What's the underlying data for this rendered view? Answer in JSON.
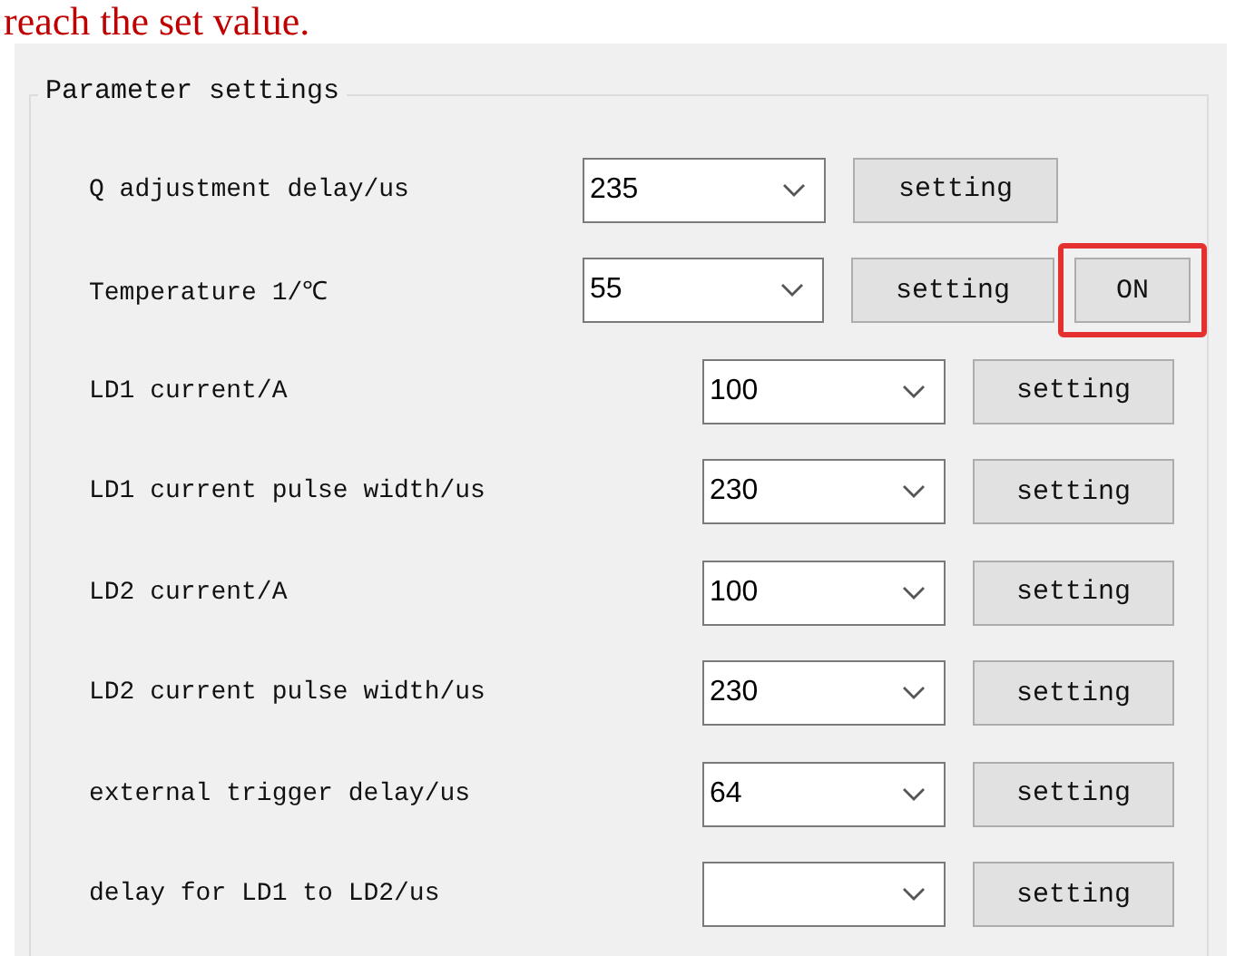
{
  "document_text": "reach the set value.",
  "group": {
    "title": "Parameter settings",
    "rows": [
      {
        "kind": "short",
        "label": "Q adjustment delay/us",
        "value": "235",
        "button": "setting"
      },
      {
        "kind": "short",
        "label": "Temperature 1/℃",
        "value": "55",
        "button": "setting",
        "toggle": {
          "label": "ON",
          "highlighted": true
        }
      },
      {
        "kind": "long",
        "label": "LD1 current/A",
        "value": "100",
        "button": "setting"
      },
      {
        "kind": "long",
        "label": "LD1 current pulse width/us",
        "value": "230",
        "button": "setting"
      },
      {
        "kind": "long",
        "label": "LD2 current/A",
        "value": "100",
        "button": "setting"
      },
      {
        "kind": "long",
        "label": "LD2 current pulse width/us",
        "value": "230",
        "button": "setting"
      },
      {
        "kind": "long",
        "label": "external trigger delay/us",
        "value": "64",
        "button": "setting"
      },
      {
        "kind": "long",
        "label": "delay for LD1 to LD2/us",
        "button": "setting"
      }
    ]
  }
}
